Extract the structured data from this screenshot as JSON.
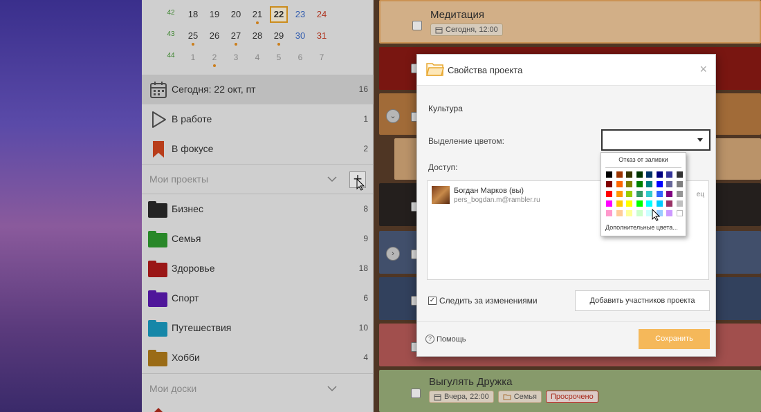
{
  "calendar": {
    "rows": [
      {
        "week": "42",
        "days": [
          {
            "d": "18",
            "style": ""
          },
          {
            "d": "19",
            "style": ""
          },
          {
            "d": "20",
            "style": ""
          },
          {
            "d": "21",
            "style": "",
            "dot": true
          },
          {
            "d": "22",
            "style": "today"
          },
          {
            "d": "23",
            "style": "blue"
          },
          {
            "d": "24",
            "style": "red"
          }
        ]
      },
      {
        "week": "43",
        "days": [
          {
            "d": "25",
            "style": "",
            "dot": true
          },
          {
            "d": "26",
            "style": ""
          },
          {
            "d": "27",
            "style": "",
            "dot": true
          },
          {
            "d": "28",
            "style": ""
          },
          {
            "d": "29",
            "style": "",
            "dot": true
          },
          {
            "d": "30",
            "style": "blue"
          },
          {
            "d": "31",
            "style": "red"
          }
        ]
      },
      {
        "week": "44",
        "days": [
          {
            "d": "1",
            "style": "dim"
          },
          {
            "d": "2",
            "style": "dim",
            "dot": true
          },
          {
            "d": "3",
            "style": "dim"
          },
          {
            "d": "4",
            "style": "dim"
          },
          {
            "d": "5",
            "style": "dim"
          },
          {
            "d": "6",
            "style": "dim"
          },
          {
            "d": "7",
            "style": "dim"
          }
        ]
      }
    ]
  },
  "sidebar": {
    "today": {
      "label": "Сегодня: 22 окт, пт",
      "count": "16"
    },
    "in_work": {
      "label": "В работе",
      "count": "1"
    },
    "focus": {
      "label": "В фокусе",
      "count": "2"
    },
    "projects_header": "Мои проекты",
    "projects": [
      {
        "label": "Бизнес",
        "count": "8",
        "color": "#2a2a2a"
      },
      {
        "label": "Семья",
        "count": "9",
        "color": "#2e9a2e"
      },
      {
        "label": "Здоровье",
        "count": "18",
        "color": "#b01a1a"
      },
      {
        "label": "Спорт",
        "count": "6",
        "color": "#5a1ab0"
      },
      {
        "label": "Путешествия",
        "count": "10",
        "color": "#1a9ac0"
      },
      {
        "label": "Хобби",
        "count": "4",
        "color": "#b07a1a"
      }
    ],
    "boards_header": "Мои доски"
  },
  "tasks": {
    "meditation": {
      "title": "Медитация",
      "date": "Сегодня, 12:00"
    },
    "walk": {
      "title": "Выгулять Дружка",
      "date": "Вчера, 22:00",
      "project": "Семья",
      "status": "Просрочено"
    }
  },
  "dialog": {
    "title": "Свойства проекта",
    "project_name": "Культура",
    "color_label": "Выделение цветом:",
    "access_label": "Доступ:",
    "member": {
      "name": "Богдан Марков (вы)",
      "email": "pers_bogdan.m@rambler.ru",
      "role": "ец"
    },
    "watch_label": "Следить за изменениями",
    "add_members": "Добавить участников проекта",
    "help": "Помощь",
    "save": "Сохранить",
    "close_symbol": "×"
  },
  "palette": {
    "no_fill": "Отказ от заливки",
    "more_colors": "Дополнительные цвета...",
    "rows": [
      [
        "#000000",
        "#993300",
        "#333300",
        "#003300",
        "#003366",
        "#000080",
        "#333399",
        "#333333"
      ],
      [
        "#800000",
        "#ff6600",
        "#808000",
        "#008000",
        "#008080",
        "#0000ff",
        "#666699",
        "#808080"
      ],
      [
        "#ff0000",
        "#ff9900",
        "#99cc00",
        "#339966",
        "#33cccc",
        "#3366ff",
        "#800080",
        "#969696"
      ],
      [
        "#ff00ff",
        "#ffcc00",
        "#ffff00",
        "#00ff00",
        "#00ffff",
        "#00ccff",
        "#993366",
        "#c0c0c0"
      ],
      [
        "#ff99cc",
        "#ffcc99",
        "#ffff99",
        "#ccffcc",
        "#ccffff",
        "#99ccff",
        "#cc99ff",
        "#ffffff"
      ]
    ]
  }
}
